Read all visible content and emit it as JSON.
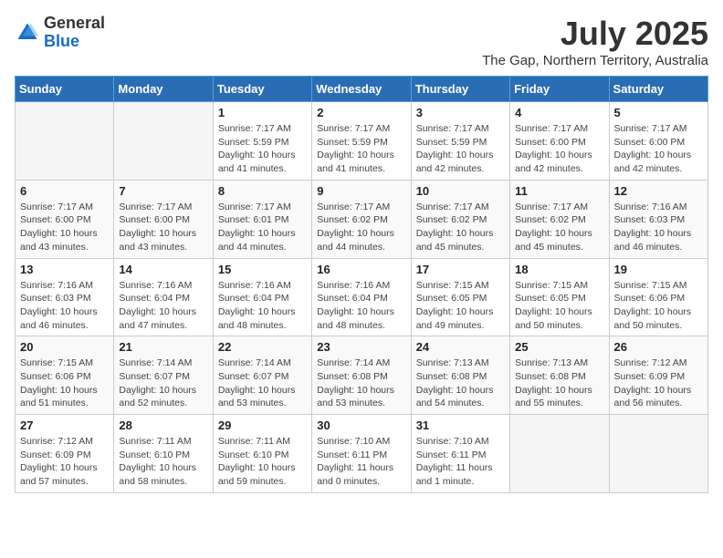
{
  "header": {
    "logo": {
      "general": "General",
      "blue": "Blue"
    },
    "title": "July 2025",
    "location": "The Gap, Northern Territory, Australia"
  },
  "calendar": {
    "weekdays": [
      "Sunday",
      "Monday",
      "Tuesday",
      "Wednesday",
      "Thursday",
      "Friday",
      "Saturday"
    ],
    "weeks": [
      [
        {
          "day": "",
          "detail": ""
        },
        {
          "day": "",
          "detail": ""
        },
        {
          "day": "1",
          "detail": "Sunrise: 7:17 AM\nSunset: 5:59 PM\nDaylight: 10 hours\nand 41 minutes."
        },
        {
          "day": "2",
          "detail": "Sunrise: 7:17 AM\nSunset: 5:59 PM\nDaylight: 10 hours\nand 41 minutes."
        },
        {
          "day": "3",
          "detail": "Sunrise: 7:17 AM\nSunset: 5:59 PM\nDaylight: 10 hours\nand 42 minutes."
        },
        {
          "day": "4",
          "detail": "Sunrise: 7:17 AM\nSunset: 6:00 PM\nDaylight: 10 hours\nand 42 minutes."
        },
        {
          "day": "5",
          "detail": "Sunrise: 7:17 AM\nSunset: 6:00 PM\nDaylight: 10 hours\nand 42 minutes."
        }
      ],
      [
        {
          "day": "6",
          "detail": "Sunrise: 7:17 AM\nSunset: 6:00 PM\nDaylight: 10 hours\nand 43 minutes."
        },
        {
          "day": "7",
          "detail": "Sunrise: 7:17 AM\nSunset: 6:00 PM\nDaylight: 10 hours\nand 43 minutes."
        },
        {
          "day": "8",
          "detail": "Sunrise: 7:17 AM\nSunset: 6:01 PM\nDaylight: 10 hours\nand 44 minutes."
        },
        {
          "day": "9",
          "detail": "Sunrise: 7:17 AM\nSunset: 6:02 PM\nDaylight: 10 hours\nand 44 minutes."
        },
        {
          "day": "10",
          "detail": "Sunrise: 7:17 AM\nSunset: 6:02 PM\nDaylight: 10 hours\nand 45 minutes."
        },
        {
          "day": "11",
          "detail": "Sunrise: 7:17 AM\nSunset: 6:02 PM\nDaylight: 10 hours\nand 45 minutes."
        },
        {
          "day": "12",
          "detail": "Sunrise: 7:16 AM\nSunset: 6:03 PM\nDaylight: 10 hours\nand 46 minutes."
        }
      ],
      [
        {
          "day": "13",
          "detail": "Sunrise: 7:16 AM\nSunset: 6:03 PM\nDaylight: 10 hours\nand 46 minutes."
        },
        {
          "day": "14",
          "detail": "Sunrise: 7:16 AM\nSunset: 6:04 PM\nDaylight: 10 hours\nand 47 minutes."
        },
        {
          "day": "15",
          "detail": "Sunrise: 7:16 AM\nSunset: 6:04 PM\nDaylight: 10 hours\nand 48 minutes."
        },
        {
          "day": "16",
          "detail": "Sunrise: 7:16 AM\nSunset: 6:04 PM\nDaylight: 10 hours\nand 48 minutes."
        },
        {
          "day": "17",
          "detail": "Sunrise: 7:15 AM\nSunset: 6:05 PM\nDaylight: 10 hours\nand 49 minutes."
        },
        {
          "day": "18",
          "detail": "Sunrise: 7:15 AM\nSunset: 6:05 PM\nDaylight: 10 hours\nand 50 minutes."
        },
        {
          "day": "19",
          "detail": "Sunrise: 7:15 AM\nSunset: 6:06 PM\nDaylight: 10 hours\nand 50 minutes."
        }
      ],
      [
        {
          "day": "20",
          "detail": "Sunrise: 7:15 AM\nSunset: 6:06 PM\nDaylight: 10 hours\nand 51 minutes."
        },
        {
          "day": "21",
          "detail": "Sunrise: 7:14 AM\nSunset: 6:07 PM\nDaylight: 10 hours\nand 52 minutes."
        },
        {
          "day": "22",
          "detail": "Sunrise: 7:14 AM\nSunset: 6:07 PM\nDaylight: 10 hours\nand 53 minutes."
        },
        {
          "day": "23",
          "detail": "Sunrise: 7:14 AM\nSunset: 6:08 PM\nDaylight: 10 hours\nand 53 minutes."
        },
        {
          "day": "24",
          "detail": "Sunrise: 7:13 AM\nSunset: 6:08 PM\nDaylight: 10 hours\nand 54 minutes."
        },
        {
          "day": "25",
          "detail": "Sunrise: 7:13 AM\nSunset: 6:08 PM\nDaylight: 10 hours\nand 55 minutes."
        },
        {
          "day": "26",
          "detail": "Sunrise: 7:12 AM\nSunset: 6:09 PM\nDaylight: 10 hours\nand 56 minutes."
        }
      ],
      [
        {
          "day": "27",
          "detail": "Sunrise: 7:12 AM\nSunset: 6:09 PM\nDaylight: 10 hours\nand 57 minutes."
        },
        {
          "day": "28",
          "detail": "Sunrise: 7:11 AM\nSunset: 6:10 PM\nDaylight: 10 hours\nand 58 minutes."
        },
        {
          "day": "29",
          "detail": "Sunrise: 7:11 AM\nSunset: 6:10 PM\nDaylight: 10 hours\nand 59 minutes."
        },
        {
          "day": "30",
          "detail": "Sunrise: 7:10 AM\nSunset: 6:11 PM\nDaylight: 11 hours\nand 0 minutes."
        },
        {
          "day": "31",
          "detail": "Sunrise: 7:10 AM\nSunset: 6:11 PM\nDaylight: 11 hours\nand 1 minute."
        },
        {
          "day": "",
          "detail": ""
        },
        {
          "day": "",
          "detail": ""
        }
      ]
    ]
  }
}
